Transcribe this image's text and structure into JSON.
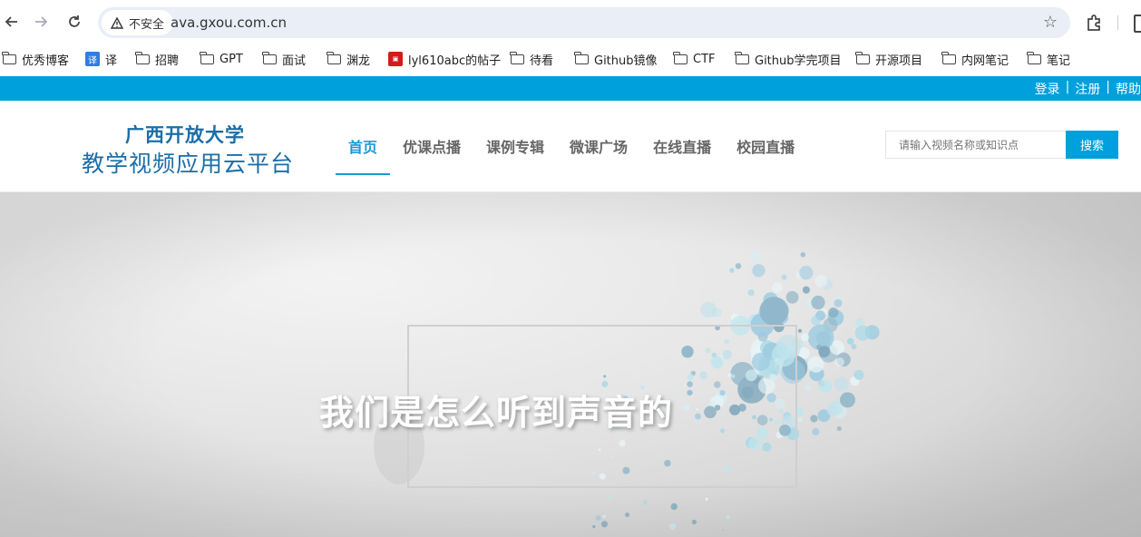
{
  "browser": {
    "security_label": "不安全",
    "url": "ava.gxou.com.cn",
    "bookmarks": [
      {
        "label": "优秀博客",
        "icon": "folder-icon"
      },
      {
        "label": "译",
        "icon": "translate-icon",
        "badge": "译"
      },
      {
        "label": "招聘",
        "icon": "folder-icon"
      },
      {
        "label": "GPT",
        "icon": "folder-icon"
      },
      {
        "label": "面试",
        "icon": "folder-icon"
      },
      {
        "label": "渊龙",
        "icon": "folder-icon"
      },
      {
        "label": "lyl610abc的帖子",
        "icon": "site-icon"
      },
      {
        "label": "待看",
        "icon": "folder-icon"
      },
      {
        "label": "Github镜像",
        "icon": "folder-icon"
      },
      {
        "label": "CTF",
        "icon": "folder-icon"
      },
      {
        "label": "Github学完项目",
        "icon": "folder-icon"
      },
      {
        "label": "开源项目",
        "icon": "folder-icon"
      },
      {
        "label": "内网笔记",
        "icon": "folder-icon"
      },
      {
        "label": "笔记",
        "icon": "folder-icon"
      }
    ]
  },
  "site": {
    "topbar": {
      "login": "登录",
      "register": "注册",
      "help": "帮助",
      "sep": "|"
    },
    "logo": {
      "line1": "广西开放大学",
      "line2": "教学视频应用云平台"
    },
    "nav": [
      {
        "label": "首页",
        "active": true
      },
      {
        "label": "优课点播",
        "active": false
      },
      {
        "label": "课例专辑",
        "active": false
      },
      {
        "label": "微课广场",
        "active": false
      },
      {
        "label": "在线直播",
        "active": false
      },
      {
        "label": "校园直播",
        "active": false
      }
    ],
    "search": {
      "placeholder": "请输入视频名称或知识点",
      "button": "搜索"
    },
    "banner": {
      "title": "我们是怎么听到声音的"
    },
    "colors": {
      "brand": "#00a0dc",
      "logo": "#1c6ea6",
      "nav_active": "#1a9ad6"
    }
  }
}
